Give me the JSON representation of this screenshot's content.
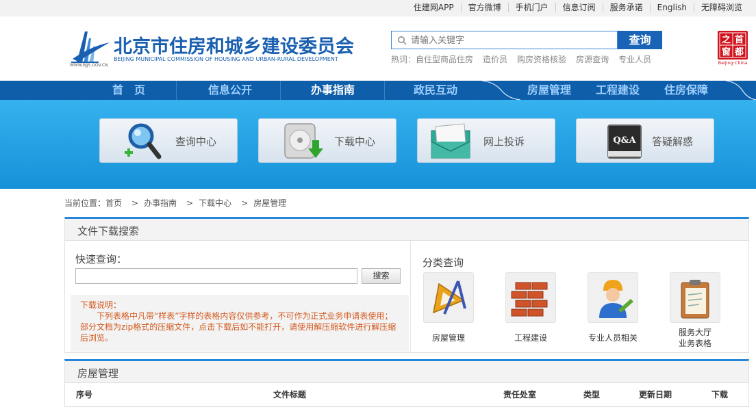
{
  "topbar": {
    "links": [
      "住建网APP",
      "官方微博",
      "手机门户",
      "信息订阅",
      "服务承诺",
      "English",
      "无障碍浏览"
    ]
  },
  "header": {
    "site_title": "北京市住房和城乡建设委员会",
    "site_subtitle": "BEIJING MUNICIPAL COMMISSION OF HOUSING AND URBAN-RURAL DEVELOPMENT",
    "site_url": "WWW.BJJS.GOV.CN",
    "search_placeholder": "请输入关键字",
    "search_button": "查询",
    "hot_label": "热词：",
    "hot_words": [
      "自住型商品住房",
      "造价员",
      "购房资格核验",
      "房源查询",
      "专业人员"
    ],
    "seal_text": [
      "之",
      "首",
      "窗",
      "都"
    ],
    "seal_caption": "Beijing·China"
  },
  "nav": {
    "items": [
      "首　页",
      "信息公开",
      "办事指南",
      "政民互动",
      "房屋管理",
      "工程建设",
      "住房保障"
    ],
    "active": "办事指南"
  },
  "banner": {
    "tiles": [
      {
        "label": "查询中心",
        "icon": "magnifier-icon"
      },
      {
        "label": "下载中心",
        "icon": "download-disk-icon"
      },
      {
        "label": "网上投诉",
        "icon": "envelope-icon"
      },
      {
        "label": "答疑解惑",
        "icon": "qa-book-icon"
      }
    ]
  },
  "breadcrumb": {
    "label": "当前位置：",
    "items": [
      "首页",
      "办事指南",
      "下载中心",
      "房屋管理"
    ],
    "separator": ">"
  },
  "search_panel": {
    "title": "文件下载搜索",
    "quick_label": "快速查询：",
    "quick_button": "搜索",
    "note_title": "下载说明：",
    "note_body": "下列表格中凡带“样表”字样的表格内容仅供参考，不可作为正式业务申请表使用；部分文档为zip格式的压缩文件，点击下载后如不能打开，请使用解压缩软件进行解压缩后浏览。",
    "category_title": "分类查询",
    "categories": [
      {
        "label": "房屋管理",
        "icon": "ruler-icon"
      },
      {
        "label": "工程建设",
        "icon": "bricks-icon"
      },
      {
        "label": "专业人员相关",
        "icon": "worker-icon"
      },
      {
        "label": "服务大厅\n业务表格",
        "icon": "clipboard-icon"
      }
    ]
  },
  "list_panel": {
    "title": "房屋管理",
    "columns": [
      "序号",
      "文件标题",
      "责任处室",
      "类型",
      "更新日期",
      "下载"
    ]
  },
  "colors": {
    "nav_bg": "#0e5ea9",
    "banner_bg": "#1691d9",
    "brand_blue": "#1a5fb0",
    "note_text": "#d2581e",
    "seal_red": "#d0121b"
  }
}
